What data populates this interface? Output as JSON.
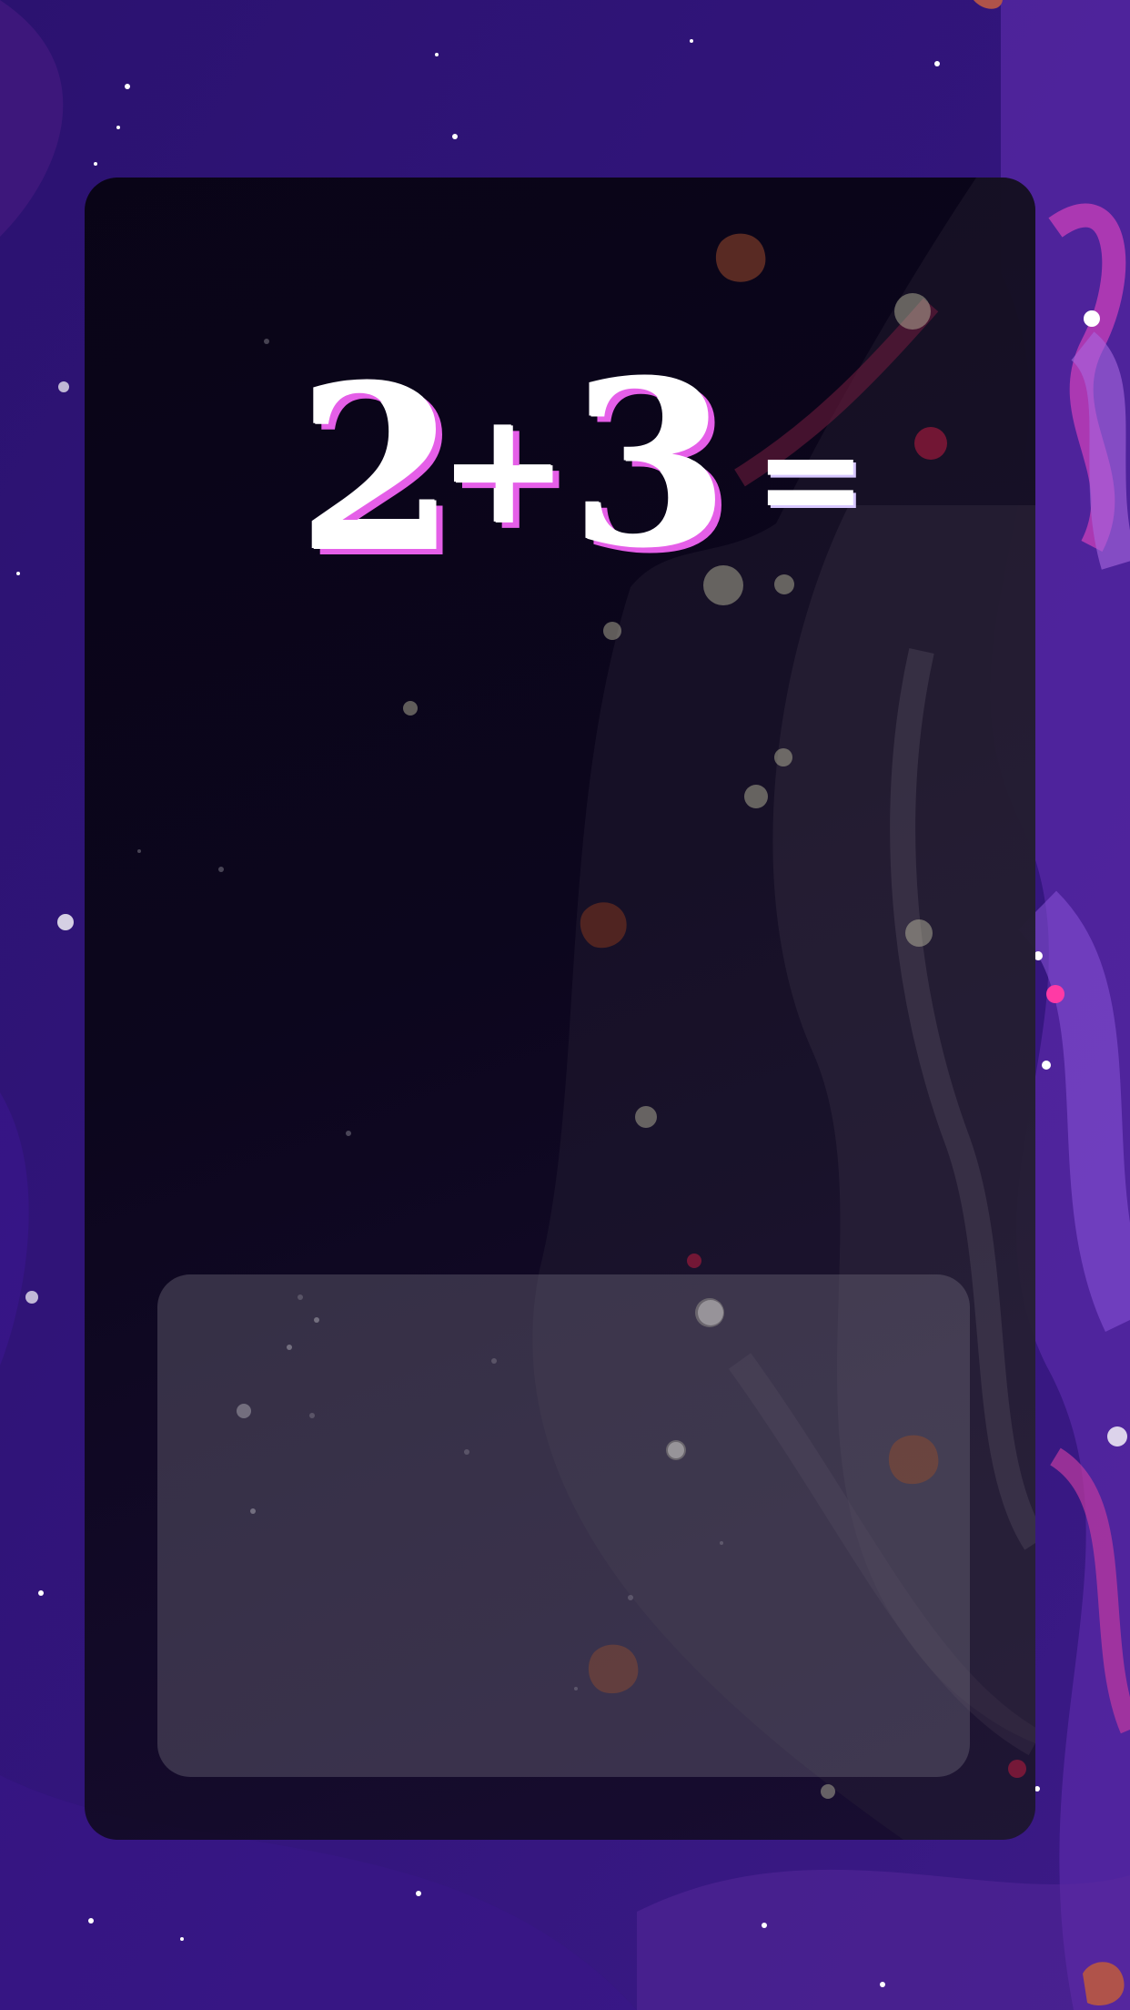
{
  "equation": {
    "operand_a": "2",
    "operator": "+",
    "operand_b": "3",
    "equals": "="
  },
  "answer": {
    "value": ""
  },
  "colors": {
    "background": "#2a1470",
    "panel": "#0a0514",
    "digit_fill": "#ffffff",
    "digit_shadow": "#e55fe8",
    "answer_box": "#6e687a"
  },
  "decorations": [
    "asteroid-icon",
    "star-icon",
    "nebula-swirl"
  ]
}
